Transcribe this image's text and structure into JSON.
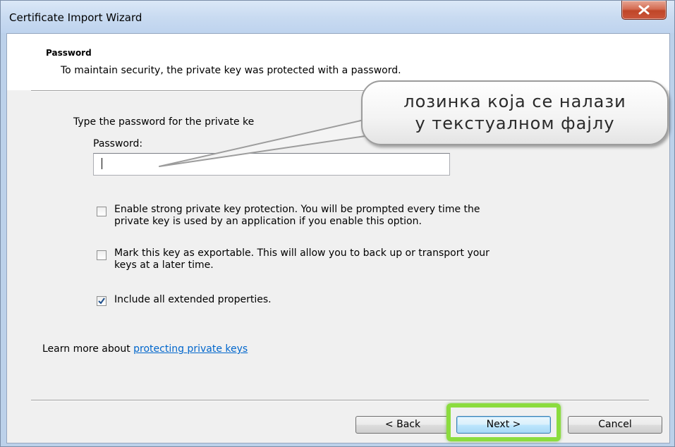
{
  "window": {
    "title": "Certificate Import Wizard",
    "close_glyph": "✕"
  },
  "header": {
    "title": "Password",
    "description": "To maintain security, the private key was protected with a password."
  },
  "form": {
    "prompt": "Type the password for the private ke",
    "password_label": "Password:",
    "password_value": ""
  },
  "options": [
    {
      "line1": "Enable strong private key protection. You will be prompted every time the",
      "line2": "private key is used by an application if you enable this option.",
      "checked": false
    },
    {
      "line1": "Mark this key as exportable. This will allow you to back up or transport your",
      "line2": "keys at a later time.",
      "checked": false
    },
    {
      "line1": "Include all extended properties.",
      "line2": "",
      "checked": true
    }
  ],
  "learn_more": {
    "prefix": "Learn more about ",
    "link": "protecting private keys"
  },
  "buttons": {
    "back": "< Back",
    "next": "Next >",
    "cancel": "Cancel"
  },
  "annotation": {
    "line1": "лозинка која се налази",
    "line2": "у текстуалном фајлу",
    "highlight_color": "#8bdc3e"
  }
}
